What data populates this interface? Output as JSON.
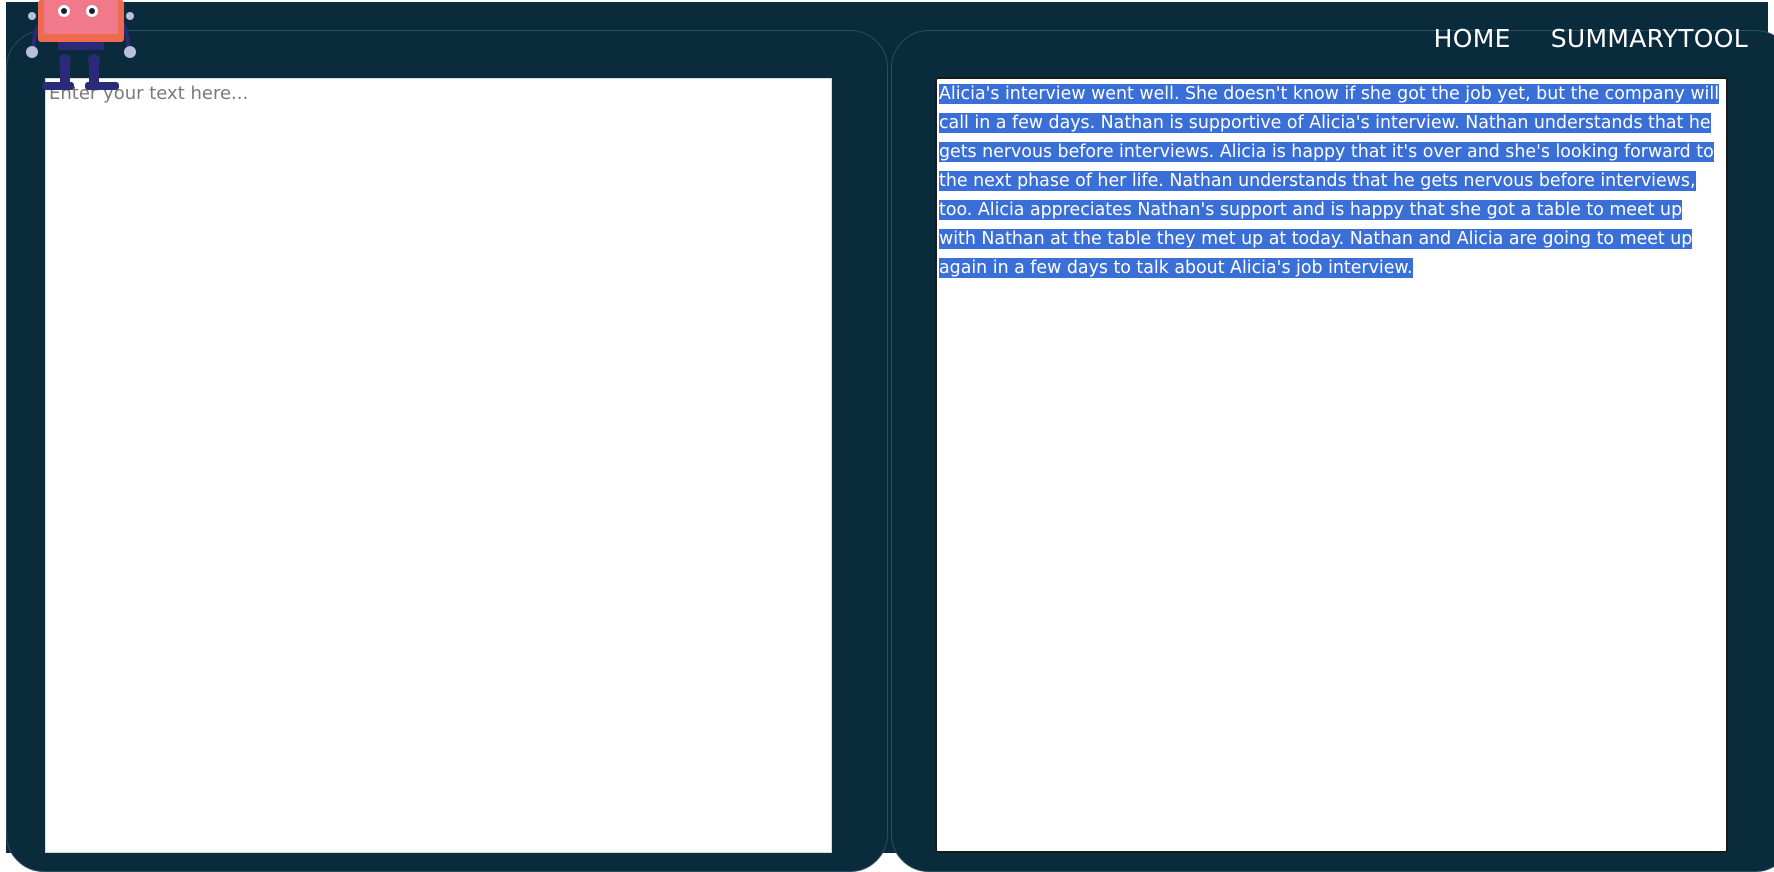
{
  "nav": {
    "home": "HOME",
    "summarytool": "SUMMARYTOOL"
  },
  "input": {
    "placeholder": "Enter your text here...",
    "value": ""
  },
  "output": {
    "summary": "Alicia's interview went well. She doesn't know if she got the job yet, but the company will call in a few days. Nathan is supportive of Alicia's interview. Nathan understands that he gets nervous before interviews. Alicia is happy that it's over and she's looking forward to the next phase of her life. Nathan understands that he gets nervous before interviews, too. Alicia appreciates Nathan's support and is happy that she got a table to meet up with Nathan at the table they met up at today. Nathan and Alicia are going to meet up again in a few days to talk about Alicia's job interview."
  },
  "colors": {
    "background": "#0a2b3b",
    "selection": "#3a6fd8",
    "robot_body": "#f06a4f",
    "robot_screen": "#f07a8a",
    "robot_limbs": "#2a2a78"
  },
  "icons": {
    "logo": "robot-logo-icon"
  }
}
